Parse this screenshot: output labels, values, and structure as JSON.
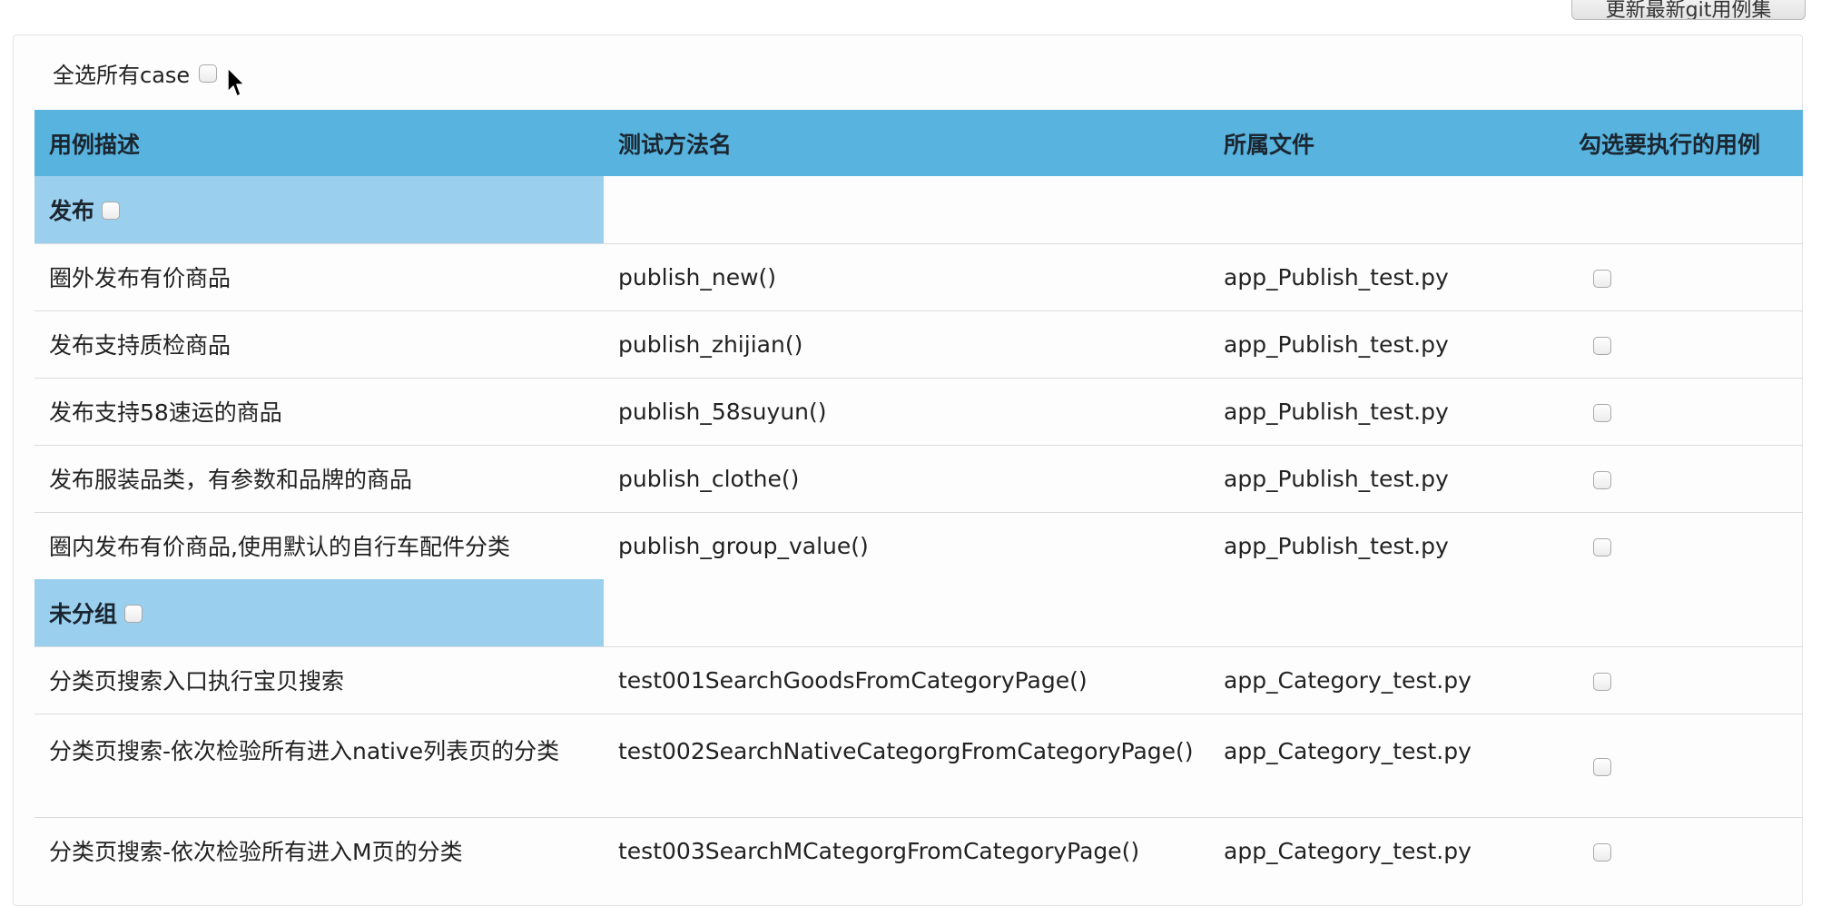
{
  "top_button": {
    "label": "更新最新git用例集"
  },
  "select_all": {
    "label": "全选所有case",
    "checked": false
  },
  "table": {
    "headers": [
      "用例描述",
      "测试方法名",
      "所属文件",
      "勾选要执行的用例"
    ],
    "groups": [
      {
        "name": "发布",
        "rows": [
          {
            "desc": "圈外发布有价商品",
            "method": "publish_new()",
            "file": "app_Publish_test.py"
          },
          {
            "desc": "发布支持质检商品",
            "method": "publish_zhijian()",
            "file": "app_Publish_test.py"
          },
          {
            "desc": "发布支持58速运的商品",
            "method": "publish_58suyun()",
            "file": "app_Publish_test.py"
          },
          {
            "desc": "发布服装品类，有参数和品牌的商品",
            "method": "publish_clothe()",
            "file": "app_Publish_test.py"
          },
          {
            "desc": "圈内发布有价商品,使用默认的自行车配件分类",
            "method": "publish_group_value()",
            "file": "app_Publish_test.py"
          }
        ]
      },
      {
        "name": "未分组",
        "rows": [
          {
            "desc": "分类页搜索入口执行宝贝搜索",
            "method": "test001SearchGoodsFromCategoryPage()",
            "file": "app_Category_test.py"
          },
          {
            "desc": "分类页搜索-依次检验所有进入native列表页的分类",
            "method": "test002SearchNativeCategorgFromCategoryPage()",
            "file": "app_Category_test.py"
          },
          {
            "desc": "分类页搜索-依次检验所有进入M页的分类",
            "method": "test003SearchMCategorgFromCategoryPage()",
            "file": "app_Category_test.py"
          }
        ]
      }
    ]
  },
  "colors": {
    "header_bg": "#58b4df",
    "group_bg": "#9bcfee",
    "row_border": "#dcdcdc"
  },
  "icons": {
    "cursor": "arrow-cursor-icon",
    "checkbox": "checkbox-icon"
  }
}
